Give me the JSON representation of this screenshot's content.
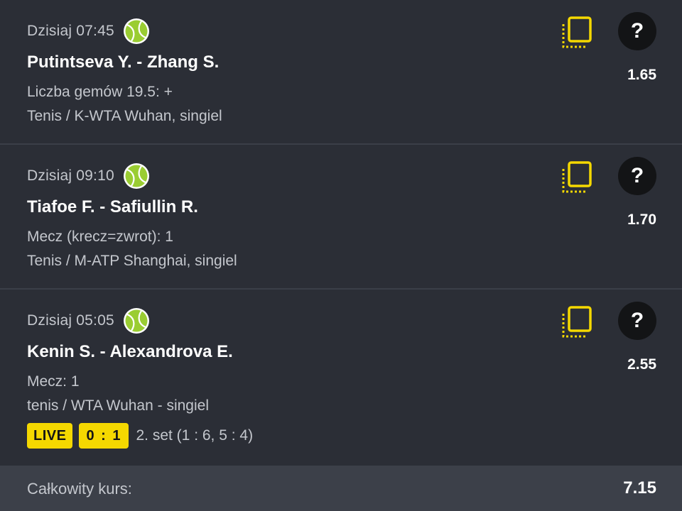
{
  "colors": {
    "background": "#2b2e36",
    "accent": "#f5d800",
    "secondary_text": "#c4c7cd",
    "footer_bg": "#3c4049"
  },
  "bets": [
    {
      "time": "Dzisiaj 07:45",
      "sport_icon": "tennis-ball-icon",
      "match": "Putintseva Y. - Zhang S.",
      "market": "Liczba gemów 19.5: +",
      "league": "Tenis / K-WTA Wuhan, singiel",
      "odds": "1.65",
      "help_label": "?"
    },
    {
      "time": "Dzisiaj 09:10",
      "sport_icon": "tennis-ball-icon",
      "match": "Tiafoe F. - Safiullin R.",
      "market": "Mecz (krecz=zwrot): 1",
      "league": "Tenis / M-ATP Shanghai, singiel",
      "odds": "1.70",
      "help_label": "?"
    },
    {
      "time": "Dzisiaj 05:05",
      "sport_icon": "tennis-ball-icon",
      "match": "Kenin S. - Alexandrova E.",
      "market": "Mecz: 1",
      "league": "tenis / WTA Wuhan - singiel",
      "odds": "2.55",
      "help_label": "?",
      "live": {
        "label": "LIVE",
        "score": "0 : 1",
        "set_info": "2. set (1 : 6, 5 : 4)"
      }
    }
  ],
  "footer": {
    "total_label": "Całkowity kurs:",
    "total_value": "7.15"
  }
}
